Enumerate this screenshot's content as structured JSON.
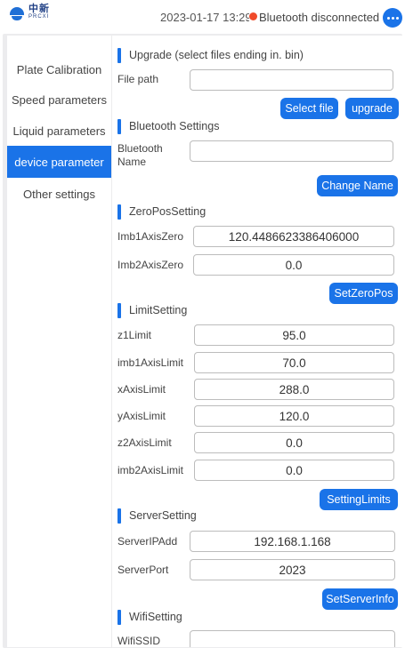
{
  "header": {
    "logo_cn": "中新",
    "logo_en": "PRCXI",
    "datetime": "2023-01-17 13:29:3",
    "bluetooth_status": "Bluetooth disconnected",
    "status_color": "#f04a2a",
    "more_icon": "more-horizontal-icon"
  },
  "sidebar": {
    "items": [
      {
        "label": "Plate Calibration"
      },
      {
        "label": "Speed parameters"
      },
      {
        "label": "Liquid parameters"
      },
      {
        "label": "device parameter",
        "active": true
      },
      {
        "label": "Other settings"
      }
    ]
  },
  "upgrade": {
    "title": "Upgrade (select files ending in. bin)",
    "file_path_label": "File path",
    "file_path_value": "",
    "select_file_button": "Select file",
    "upgrade_button": "upgrade"
  },
  "bluetooth": {
    "title": "Bluetooth Settings",
    "name_label_line1": "Bluetooth",
    "name_label_line2": "Name",
    "name_value": "",
    "change_name_button": "Change Name"
  },
  "zero_pos": {
    "title": "ZeroPosSetting",
    "imb1_label": "Imb1AxisZero",
    "imb1_value": "120.4486623386406000",
    "imb2_label": "Imb2AxisZero",
    "imb2_value": "0.0",
    "set_button": "SetZeroPos"
  },
  "limits": {
    "title": "LimitSetting",
    "rows": [
      {
        "label": "z1Limit",
        "value": "95.0"
      },
      {
        "label": "imb1AxisLimit",
        "value": "70.0"
      },
      {
        "label": "xAxisLimit",
        "value": "288.0"
      },
      {
        "label": "yAxisLimit",
        "value": "120.0"
      },
      {
        "label": "z2AxisLimit",
        "value": "0.0"
      },
      {
        "label": "imb2AxisLimit",
        "value": "0.0"
      }
    ],
    "set_button": "SettingLimits"
  },
  "server": {
    "title": "ServerSetting",
    "ip_label": "ServerIPAdd",
    "ip_value": "192.168.1.168",
    "port_label": "ServerPort",
    "port_value": "2023",
    "set_button": "SetServerInfo"
  },
  "wifi": {
    "title": "WifiSetting",
    "ssid_label": "WifiSSID",
    "ssid_value": ""
  },
  "colors": {
    "accent": "#1a73e8",
    "panel_bg": "#ececee"
  }
}
